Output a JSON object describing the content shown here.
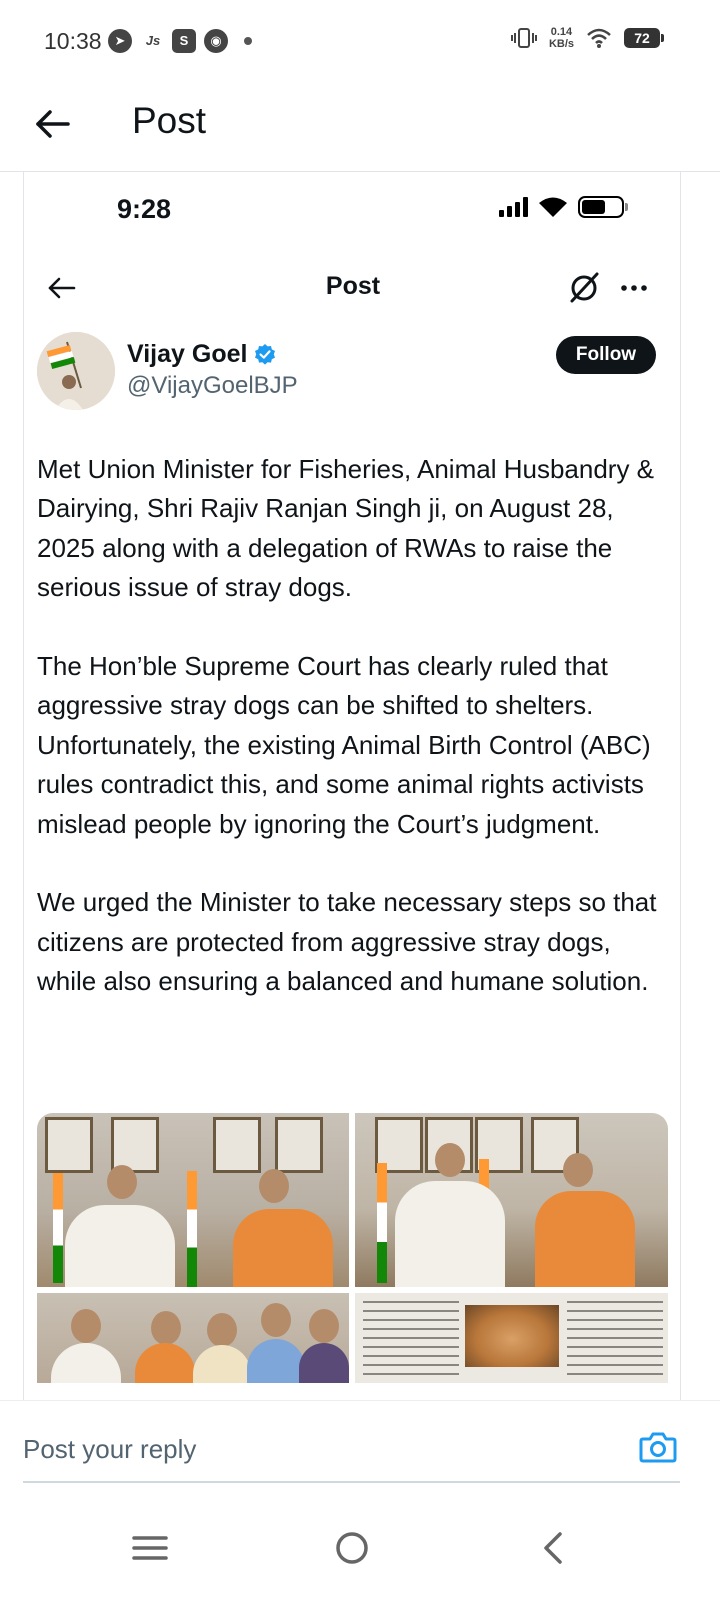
{
  "status_bar": {
    "time": "10:38",
    "net_speed_value": "0.14",
    "net_speed_unit": "KB/s",
    "battery": "72"
  },
  "header": {
    "title": "Post"
  },
  "embedded_screenshot": {
    "status_time": "9:28",
    "title": "Post",
    "author": {
      "name": "Vijay Goel",
      "handle": "@VijayGoelBJP",
      "verified": true
    },
    "follow_label": "Follow",
    "paragraphs": [
      "Met Union Minister for Fisheries, Animal Husbandry & Dairying, Shri Rajiv Ranjan Singh ji, on August 28, 2025 along with a delegation of RWAs to raise the serious issue of stray dogs.",
      "The Hon’ble Supreme Court has clearly ruled that aggressive stray dogs can be shifted to shelters. Unfortunately, the existing Animal Birth Control (ABC) rules contradict this, and some animal rights activists mislead people by ignoring the Court’s judgment.",
      "We urged the Minister to take necessary steps so that citizens are protected from aggressive stray dogs, while also ensuring a balanced and humane solution."
    ]
  },
  "reply": {
    "placeholder": "Post your reply"
  },
  "colors": {
    "accent": "#1d9bf0",
    "text": "#0f1419",
    "secondary_text": "#536471",
    "follow_bg": "#0f1419"
  },
  "icons": {
    "back": "arrow-left-icon",
    "grok": "grok-icon",
    "more": "more-horizontal-icon",
    "verified": "verified-badge-icon",
    "camera": "camera-icon",
    "nav_menu": "menu-icon",
    "nav_home": "home-circle-icon",
    "nav_back": "chevron-left-icon"
  }
}
